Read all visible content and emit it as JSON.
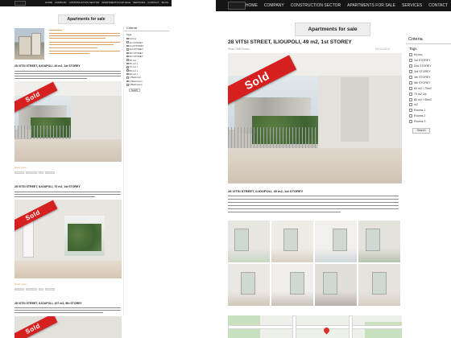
{
  "nav": {
    "items": [
      "HOME",
      "COMPANY",
      "CONSTRUCTION SECTOR",
      "APARTMENTS FOR SALE",
      "SERVICES",
      "CONTACT"
    ],
    "left_extra": "BLOG"
  },
  "banner": {
    "text": "Apartments for sale"
  },
  "sidebar": {
    "title": "Criteria",
    "subtitle": "Tags",
    "left_options": [
      "Κήπος",
      "1st STOREY",
      "2nd STOREY",
      "3rd STOREY",
      "4th STOREY",
      "5th STOREY",
      "60 m2",
      "65 m2 +",
      "70 m2 +",
      "80 m2 +",
      "90 m2 +",
      "1 Bedroom",
      "2 Bedrooms",
      "3 Bedrooms"
    ],
    "right_options": [
      "Κήπος",
      "1st STOREY",
      "2nd STOREY",
      "3rd STOREY",
      "4th STOREY",
      "5th STOREY",
      "60 m2 / 70m2",
      "70 m2 Up",
      "80 m2 / 90m2",
      "m2",
      "Rooms 1",
      "Rooms 2",
      "Rooms 3"
    ],
    "search_label": "Search"
  },
  "left_listings": [
    {
      "title": "28 VITSI STREET, ILIOUPOLI, 49 m2, 1st STOREY",
      "ribbon": "Sold",
      "readmore": "Read more..."
    },
    {
      "title": "28 VITSI STREET, ILIOUPOLI, 70 m2, 1st STOREY",
      "ribbon": "Sold",
      "readmore": "Read more..."
    },
    {
      "title": "28 VITSI STREET, ILIOUPOLI, 107 m2, 5th STOREY",
      "ribbon": "Sold"
    }
  ],
  "detail": {
    "title": "28 VITSI STREET, ILIOUPOLI, 49 m2, 1st STOREY",
    "meta_left": "Read 2960 times",
    "meta_right": "29-04-2016",
    "ribbon": "Sold",
    "subtitle": "28 VITSI STREET, ILIOUPOLI, 49 m2, 1st STOREY"
  },
  "colors": {
    "topbar": "#151515",
    "ribbon": "#d62020",
    "accent_link": "#d9a15b"
  }
}
